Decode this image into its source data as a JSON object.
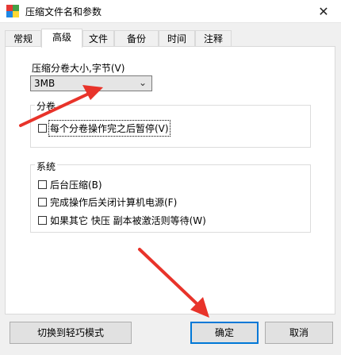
{
  "window": {
    "title": "压缩文件名和参数",
    "close_symbol": "✕"
  },
  "tabs": [
    {
      "label": "常规",
      "active": false
    },
    {
      "label": "高级",
      "active": true
    },
    {
      "label": "文件",
      "active": false
    },
    {
      "label": "备份",
      "active": false
    },
    {
      "label": "时间",
      "active": false
    },
    {
      "label": "注释",
      "active": false
    }
  ],
  "volume": {
    "label": "压缩分卷大小,字节(V)",
    "selected": "3MB"
  },
  "group_volume": {
    "title": "分卷",
    "checkbox_pause": {
      "label": "每个分卷操作完之后暂停(V)",
      "checked": false
    }
  },
  "group_system": {
    "title": "系统",
    "checkbox_background": {
      "label": "后台压缩(B)",
      "checked": false
    },
    "checkbox_shutdown": {
      "label": "完成操作后关闭计算机电源(F)",
      "checked": false
    },
    "checkbox_wait": {
      "label": "如果其它 快压 副本被激活则等待(W)",
      "checked": false
    }
  },
  "buttons": {
    "light_mode": "切换到轻巧模式",
    "ok": "确定",
    "cancel": "取消"
  },
  "colors": {
    "annotation_arrow": "#e8332a",
    "default_button_border": "#0078d7"
  }
}
